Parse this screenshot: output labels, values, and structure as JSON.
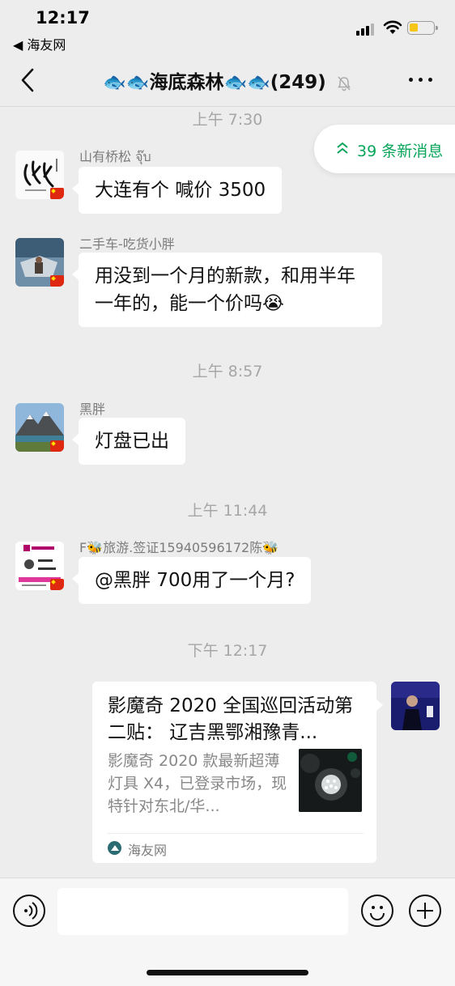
{
  "status_bar": {
    "time": "12:17",
    "back_app": "◀ 海友网"
  },
  "nav": {
    "title_prefix": "🐟🐟",
    "title": "海底森林",
    "title_suffix": "🐟🐟",
    "member_count": "(249)"
  },
  "new_messages": {
    "label": "39 条新消息",
    "accent": "#07a55a"
  },
  "messages": [
    {
      "timestamp": "上午 7:30",
      "sender": "山有桥松 จุ๊บ",
      "text": "大连有个 喊价 3500"
    },
    {
      "sender": "二手车-吃货小胖",
      "text": "用没到一个月的新款，和用半年一年的，能一个价吗😭"
    },
    {
      "timestamp": "上午 8:57",
      "sender": "黑胖",
      "text": "灯盘已出"
    },
    {
      "timestamp": "上午 11:44",
      "sender": "F🐝旅游.签证15940596172陈🐝",
      "text": "@黑胖 700用了一个月?"
    },
    {
      "timestamp": "下午 12:17"
    }
  ],
  "link_card": {
    "title": "影魔奇 2020 全国巡回活动第二贴： 辽吉黑鄂湘豫青...",
    "description": "影魔奇 2020 款最新超薄灯具 X4，已登录市场，现特针对东北/华...",
    "source": "海友网"
  },
  "colors": {
    "background": "#ededed",
    "bubble": "#ffffff",
    "timestamp": "#a6a6a6"
  }
}
